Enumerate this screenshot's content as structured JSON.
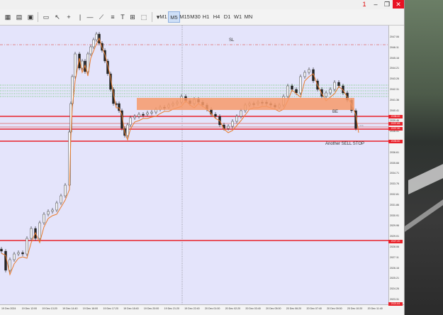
{
  "window": {
    "controls": {
      "minimize": "–",
      "maximize": "❐",
      "close": "✕"
    },
    "badge_count": "1"
  },
  "toolbar": {
    "timeframes": [
      "M1",
      "M5",
      "M15",
      "M30",
      "H1",
      "H4",
      "D1",
      "W1",
      "MN"
    ],
    "active_timeframe": "M5",
    "tool_icons": [
      "new-chart-icon",
      "chart-type-icon",
      "zoom-icon",
      "crosshair-icon",
      "cursor-icon",
      "crosshair-plus-icon",
      "vertical-line-icon",
      "trend-line-icon",
      "horizontal-line-icon",
      "text-icon",
      "label-icon",
      "shapes-icon"
    ]
  },
  "chart": {
    "annotations": {
      "sl": "SL",
      "be": "BE",
      "sell_stop": "Another SELL STOP"
    },
    "price_tags": [
      "2038.00",
      "2037.65",
      "2037.30",
      "2035.50",
      "2027.20",
      "2021.64"
    ],
    "price_axis": [
      "2047.06",
      "2046.11",
      "2045.16",
      "2044.21",
      "2043.26",
      "2042.31",
      "2041.36",
      "2040.41",
      "2039.46",
      "2038.51",
      "2037.56",
      "2036.61",
      "2035.66",
      "2034.71",
      "2033.76",
      "2032.81",
      "2031.86",
      "2030.91",
      "2029.96",
      "2029.01",
      "2028.06",
      "2027.11",
      "2026.16",
      "2025.21",
      "2024.26",
      "2023.31",
      "2022.36"
    ],
    "time_axis": [
      "19 Dec 2024",
      "19 Dec 12:00",
      "19 Dec 13:20",
      "19 Dec 14:40",
      "19 Dec 16:00",
      "19 Dec 17:20",
      "19 Dec 18:40",
      "19 Dec 20:00",
      "19 Dec 21:20",
      "19 Dec 22:40",
      "20 Dec 01:00",
      "20 Dec 02:20",
      "20 Dec 03:40",
      "20 Dec 05:00",
      "20 Dec 06:20",
      "20 Dec 07:40",
      "20 Dec 09:00",
      "20 Dec 10:20",
      "20 Dec 11:40"
    ],
    "bid_marker": "~~"
  }
}
